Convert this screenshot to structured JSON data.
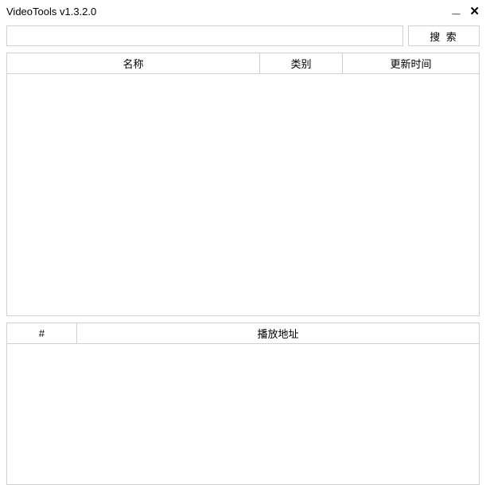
{
  "window": {
    "title": "VideoTools v1.3.2.0"
  },
  "search": {
    "value": "",
    "placeholder": "",
    "button_label": "搜 索"
  },
  "top_table": {
    "columns": {
      "name": "名称",
      "category": "类别",
      "update_time": "更新时间"
    },
    "rows": []
  },
  "bottom_table": {
    "columns": {
      "num": "#",
      "play_url": "播放地址"
    },
    "rows": []
  }
}
